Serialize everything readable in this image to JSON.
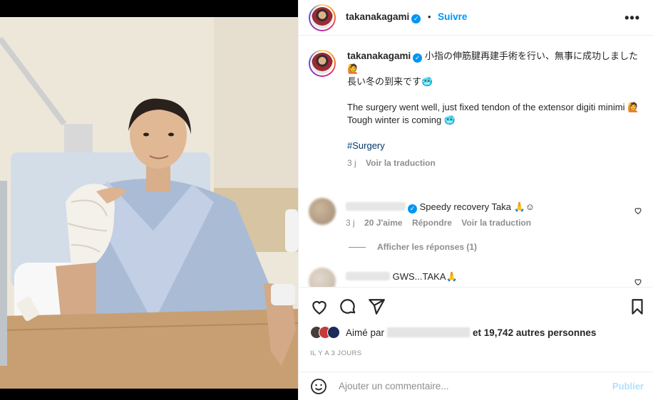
{
  "post": {
    "username": "takanakagami",
    "follow_label": "Suivre",
    "separator": "•",
    "more_icon": "more-horizontal-icon"
  },
  "caption": {
    "username": "takanakagami",
    "line1": "小指の伸筋腱再建手術を行い、無事に成功しました🙋",
    "line2": "長い冬の到来です🥶",
    "line3": "The surgery went well, just fixed tendon of the extensor digiti minimi 🙋",
    "line4": "Tough winter is coming 🥶",
    "hashtag": "#Surgery",
    "age": "3 j",
    "translate": "Voir la traduction"
  },
  "comments": [
    {
      "text": "Speedy recovery Taka 🙏☺",
      "age": "3 j",
      "likes": "20 J'aime",
      "reply": "Répondre",
      "translate": "Voir la traduction",
      "replies": "Afficher les réponses (1)"
    },
    {
      "text": "GWS...TAKA🙏"
    }
  ],
  "likes": {
    "prefix": "Aimé par",
    "suffix": "et 19,742 autres personnes"
  },
  "timestamp": "IL Y A 3 JOURS",
  "comment_box": {
    "placeholder": "Ajouter un commentaire...",
    "publish": "Publier"
  },
  "colors": {
    "accent": "#0095f6",
    "publish_disabled": "#b2dffc",
    "secondary_text": "#8e8e8e"
  }
}
